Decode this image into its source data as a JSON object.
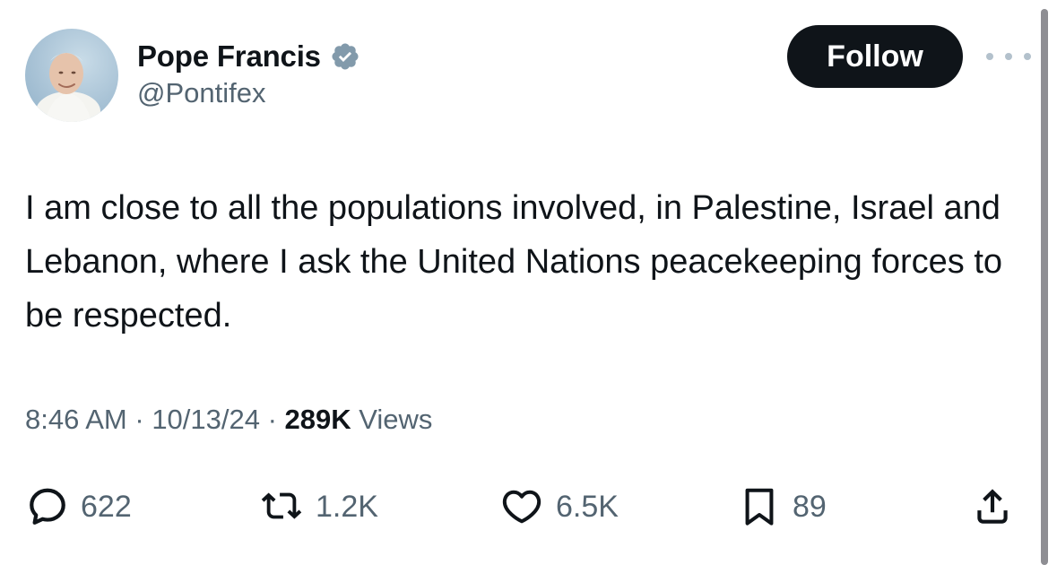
{
  "author": {
    "display_name": "Pope Francis",
    "handle": "@Pontifex",
    "verified": true,
    "verified_color": "#829aab"
  },
  "header": {
    "follow_label": "Follow"
  },
  "tweet": {
    "text": "I am close to all the populations involved, in Palestine, Israel and Lebanon, where I ask the United Nations peacekeeping forces to be respected."
  },
  "meta": {
    "time": "8:46 AM",
    "separator": " · ",
    "date": "10/13/24",
    "views_count": "289K",
    "views_label": " Views"
  },
  "actions": {
    "replies": "622",
    "reposts": "1.2K",
    "likes": "6.5K",
    "bookmarks": "89"
  },
  "icons": {
    "reply": "reply-icon",
    "repost": "repost-icon",
    "like": "heart-icon",
    "bookmark": "bookmark-icon",
    "share": "share-icon",
    "more": "more-icon"
  },
  "colors": {
    "text_primary": "#0f1419",
    "text_secondary": "#536471",
    "follow_bg": "#0f1419",
    "follow_text": "#ffffff"
  }
}
